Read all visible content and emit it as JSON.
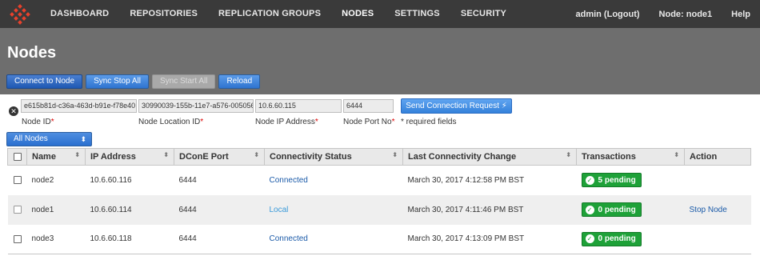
{
  "nav": {
    "items": [
      "DASHBOARD",
      "REPOSITORIES",
      "REPLICATION GROUPS",
      "NODES",
      "SETTINGS",
      "SECURITY"
    ],
    "active": "NODES",
    "user": "admin (Logout)",
    "node": "Node: node1",
    "help": "Help",
    "logo_icon": "wandisco-diamond-icon",
    "accent_color": "#e8412c"
  },
  "page": {
    "title": "Nodes"
  },
  "toolbar": {
    "connect_label": "Connect to Node",
    "sync_stop_label": "Sync Stop All",
    "sync_start_label": "Sync Start All",
    "reload_label": "Reload"
  },
  "connect_form": {
    "node_id_value": "e615b81d-c36a-463d-b91e-f78e40",
    "node_location_value": "30990039-155b-11e7-a576-005056",
    "node_ip_value": "10.6.60.115",
    "node_port_value": "6444",
    "node_id_label": "Node ID",
    "node_location_label": "Node Location ID",
    "node_ip_label": "Node IP Address",
    "node_port_label": "Node Port No",
    "required_note": "* required fields",
    "send_label": "Send Connection Request"
  },
  "filter": {
    "selected": "All Nodes"
  },
  "table": {
    "columns": [
      "Name",
      "IP Address",
      "DConE Port",
      "Connectivity Status",
      "Last Connectivity Change",
      "Transactions",
      "Action"
    ],
    "rows": [
      {
        "name": "node2",
        "ip": "10.6.60.116",
        "port": "6444",
        "status": "Connected",
        "last_change": "March 30, 2017 4:12:58 PM BST",
        "transactions": "5 pending",
        "action": ""
      },
      {
        "name": "node1",
        "ip": "10.6.60.114",
        "port": "6444",
        "status": "Local",
        "last_change": "March 30, 2017 4:11:46 PM BST",
        "transactions": "0 pending",
        "action": "Stop Node"
      },
      {
        "name": "node3",
        "ip": "10.6.60.118",
        "port": "6444",
        "status": "Connected",
        "last_change": "March 30, 2017 4:13:09 PM BST",
        "transactions": "0 pending",
        "action": ""
      }
    ]
  }
}
